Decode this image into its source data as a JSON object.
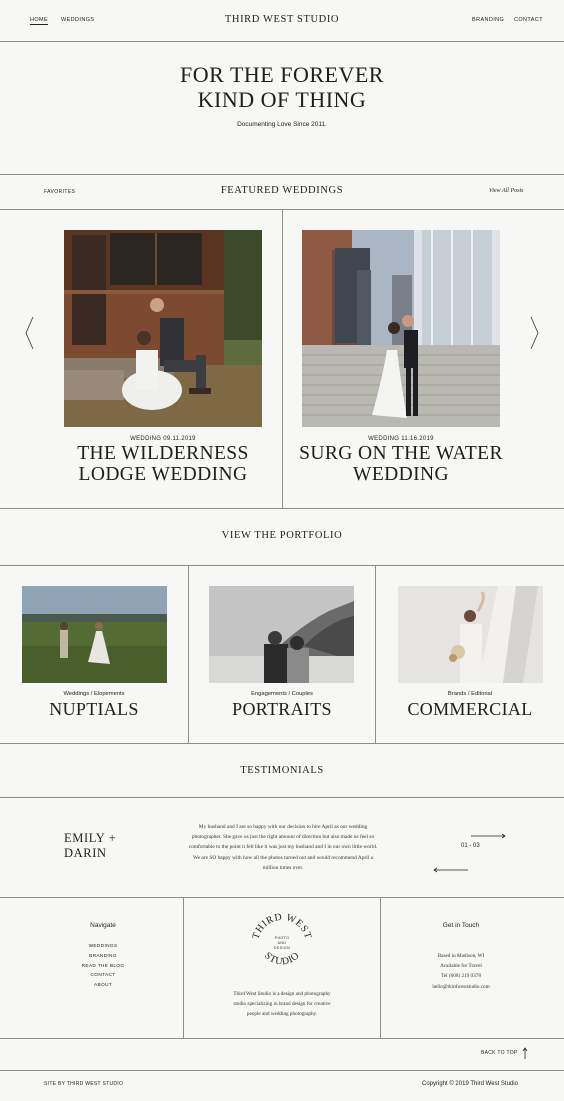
{
  "header": {
    "nav_left": [
      "HOME",
      "WEDDINGS"
    ],
    "brand": "THIRD WEST STUDIO",
    "nav_right": [
      "BRANDING",
      "CONTACT"
    ]
  },
  "hero": {
    "title_line1": "FOR THE FOREVER",
    "title_line2": "KIND OF THING",
    "subtitle": "Documenting Love Since 2011."
  },
  "featured": {
    "left_label": "FAVORITES",
    "title": "FEATURED WEDDINGS",
    "view_all": "View All Posts",
    "prev_icon": "chevron-left-icon",
    "next_icon": "chevron-right-icon",
    "posts": [
      {
        "date": "WEDDING 09.11.2019",
        "title_line1": "THE WILDERNESS",
        "title_line2": "LODGE WEDDING"
      },
      {
        "date": "WEDDING 11.16.2019",
        "title_line1": "SURG ON THE WATER",
        "title_line2": "WEDDING"
      }
    ]
  },
  "portfolio": {
    "title": "VIEW THE PORTFOLIO",
    "items": [
      {
        "category": "Weddings / Elopements",
        "title": "NUPTIALS"
      },
      {
        "category": "Engagements / Couples",
        "title": "PORTRAITS"
      },
      {
        "category": "Brands / Editorial",
        "title": "COMMERCIAL"
      }
    ]
  },
  "testimonials": {
    "title": "TESTIMONIALS",
    "name_line1": "EMILY +",
    "name_line2": "DARIN",
    "quote_lines": [
      "My husband and I are so happy with our decision to hire April as our wedding",
      "photographer. She gave us just the right amount of direction but also made us feel so",
      "comfortable to the point it felt like it was just my husband and I in our own little world.",
      "We are SO happy with how all the photos turned out and would recommend April a",
      "million times over."
    ],
    "counter": "01 - 03"
  },
  "footer": {
    "navigate_title": "Navigate",
    "nav_links": [
      "WEDDINGS",
      "BRANDING",
      "READ THE BLOG",
      "CONTACT",
      "ABOUT"
    ],
    "logo": {
      "arc_top": "THIRD WEST",
      "arc_bottom": "STUDIO",
      "center_lines": [
        "PHOTO",
        "AND",
        "DESIGN"
      ]
    },
    "about_lines": [
      "Third West Studio is a design and photography",
      "studio specializing in brand design for creative",
      "people and wedding photography."
    ],
    "contact_title": "Get in Touch",
    "contact_lines": [
      "Based in Madison, WI",
      "Available for Travel",
      "Tel (608) 219 0378",
      "hello@thirdweststudio.com"
    ],
    "back_to_top": "BACK TO TOP",
    "credit": "SITE BY THIRD WEST STUDIO",
    "copyright": "Copyright © 2019 Third West Studio"
  }
}
